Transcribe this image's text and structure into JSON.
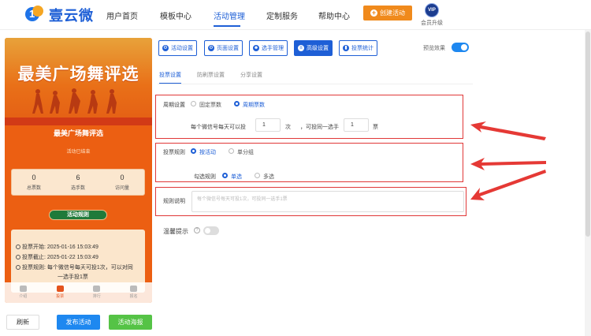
{
  "brand": {
    "name": "壹云微",
    "mark_digit": "1"
  },
  "nav": [
    {
      "label": "用户首页"
    },
    {
      "label": "模板中心"
    },
    {
      "label": "活动管理"
    },
    {
      "label": "定制服务"
    },
    {
      "label": "帮助中心"
    }
  ],
  "header": {
    "create_label": "创建活动",
    "vip_badge": "VIP",
    "vip_label": "会员升级"
  },
  "preview": {
    "banner_title": "最美广场舞评选",
    "subtitle": "最美广场舞评选",
    "status": "活动已结束",
    "stats": [
      {
        "value": "0",
        "label": "总票数"
      },
      {
        "value": "6",
        "label": "选手数"
      },
      {
        "value": "0",
        "label": "访问量"
      }
    ],
    "rule_button": "活动规则",
    "rules": [
      "投票开始:  2025-01-16 15:03:49",
      "投票截止:  2025-01-22 15:03:49",
      "投票规则:  每个微信号每天可投1次，可以对同",
      "一选手投1票"
    ],
    "tabs": [
      {
        "label": "介绍"
      },
      {
        "label": "投票"
      },
      {
        "label": "排行"
      },
      {
        "label": "报名"
      }
    ]
  },
  "footer": {
    "refresh": "刷新",
    "publish": "发布活动",
    "poster": "活动海报"
  },
  "toolbar": [
    {
      "label": "活动设置",
      "icon": "gear-icon"
    },
    {
      "label": "页面设置",
      "icon": "page-icon"
    },
    {
      "label": "选手管理",
      "icon": "users-icon"
    },
    {
      "label": "高级设置",
      "icon": "settings-icon"
    },
    {
      "label": "投票统计",
      "icon": "chart-icon"
    }
  ],
  "preview_toggle": {
    "label": "预览效果"
  },
  "subtabs": [
    {
      "label": "投票设置"
    },
    {
      "label": "防刷票设置"
    },
    {
      "label": "分享设置"
    }
  ],
  "cycle": {
    "label": "周期设置",
    "options": [
      "固定票数",
      "周期票数"
    ],
    "per_day_label": "每个微信号每天可以投",
    "per_day_value": "1",
    "unit_times": "次",
    "per_player_label": "，可投同一选手",
    "per_player_value": "1",
    "unit_votes": "票"
  },
  "vote_rule": {
    "label": "投票规则",
    "options": [
      "按活动",
      "单分组"
    ],
    "check_label": "勾选规则",
    "check_options": [
      "单选",
      "多选"
    ]
  },
  "rule_desc": {
    "label": "规则说明",
    "placeholder": "每个微信号每天可投1次，可投同一选手1票"
  },
  "warm_tip": {
    "label": "温馨提示",
    "help": "?"
  }
}
